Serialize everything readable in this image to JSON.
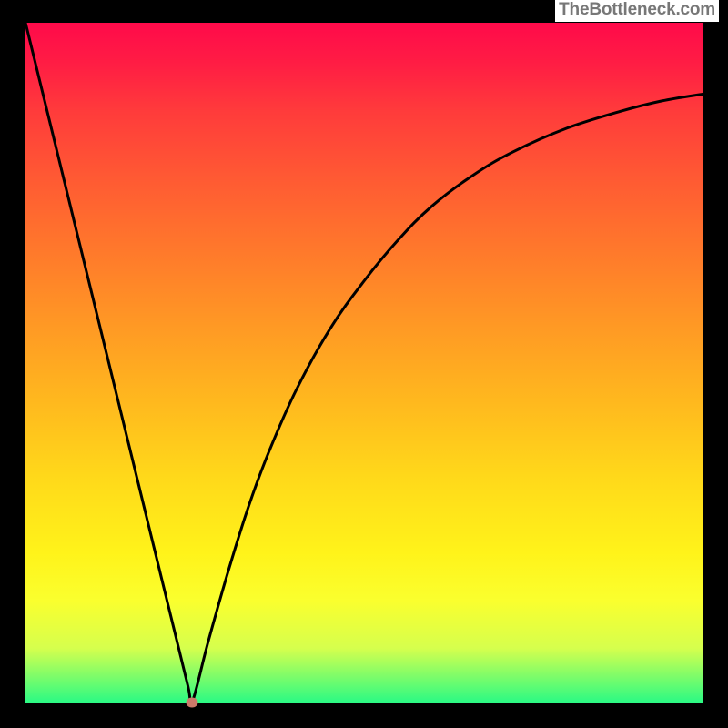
{
  "attribution": "TheBottleneck.com",
  "chart_data": {
    "type": "line",
    "x": [
      0.0,
      0.03,
      0.06,
      0.09,
      0.12,
      0.15,
      0.18,
      0.21,
      0.24,
      0.246,
      0.27,
      0.3,
      0.33,
      0.36,
      0.4,
      0.45,
      0.5,
      0.55,
      0.6,
      0.66,
      0.72,
      0.8,
      0.88,
      0.94,
      1.0
    ],
    "values": [
      1.0,
      0.878,
      0.756,
      0.634,
      0.512,
      0.39,
      0.268,
      0.146,
      0.024,
      0.0,
      0.09,
      0.195,
      0.29,
      0.37,
      0.46,
      0.55,
      0.62,
      0.68,
      0.73,
      0.775,
      0.81,
      0.845,
      0.87,
      0.885,
      0.895
    ],
    "marker": {
      "x": 0.246,
      "y": 0.0
    },
    "xlim": [
      0,
      1
    ],
    "ylim": [
      0,
      1
    ]
  },
  "colors": {
    "curve_stroke": "#000000",
    "marker_fill": "#cc7a6a",
    "frame_border": "#000000"
  }
}
